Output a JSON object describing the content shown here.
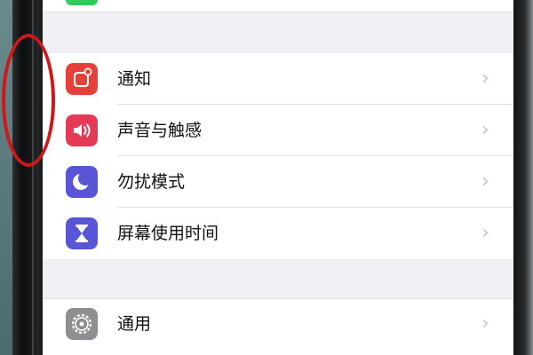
{
  "settings": {
    "items": [
      {
        "label": "通知",
        "icon": "notifications-icon",
        "color": "#e5413a"
      },
      {
        "label": "声音与触感",
        "icon": "speaker-icon",
        "color": "#e53a56"
      },
      {
        "label": "勿扰模式",
        "icon": "moon-icon",
        "color": "#5856d6"
      },
      {
        "label": "屏幕使用时间",
        "icon": "hourglass-icon",
        "color": "#5856d6"
      }
    ],
    "general": {
      "label": "通用",
      "icon": "gear-icon",
      "color": "#8e8e93"
    },
    "chevron": "›"
  },
  "annotation": {
    "color": "#d01818"
  }
}
